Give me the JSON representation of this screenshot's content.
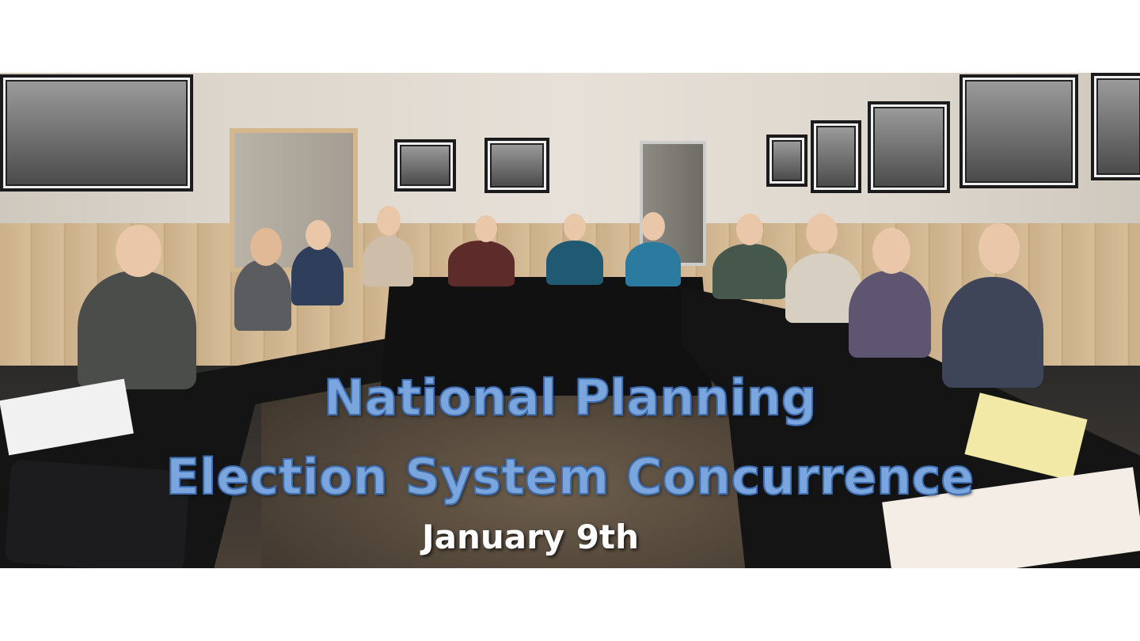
{
  "slide": {
    "title_line1": "National Planning",
    "title_line2": "Election System Concurrence",
    "date": "January 9th"
  },
  "colors": {
    "title_fill": "#7aa6dd",
    "title_outline": "#3f6fb0",
    "date_text": "#ffffff",
    "background": "#ffffff"
  }
}
